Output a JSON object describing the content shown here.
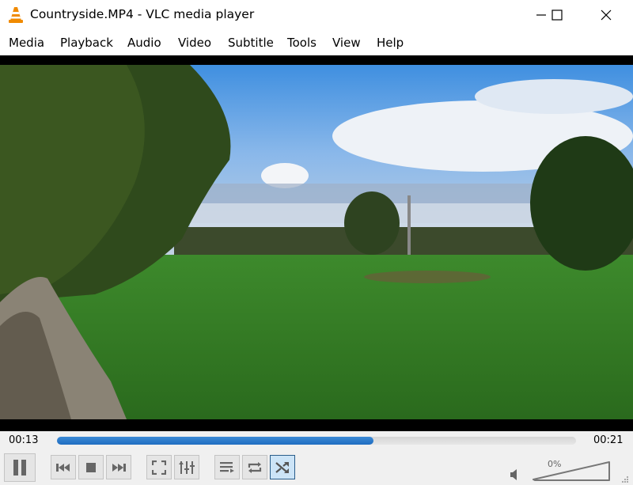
{
  "window": {
    "title": "Countryside.MP4 - VLC media player",
    "app_icon": "vlc-cone-icon",
    "controls": [
      "minimize-icon",
      "maximize-icon",
      "close-icon"
    ]
  },
  "menu": {
    "items": [
      {
        "label": "Media"
      },
      {
        "label": "Playback"
      },
      {
        "label": "Audio"
      },
      {
        "label": "Video"
      },
      {
        "label": "Subtitle"
      },
      {
        "label": "Tools"
      },
      {
        "label": "View"
      },
      {
        "label": "Help"
      }
    ]
  },
  "video": {
    "description": "Countryside scene: green field, trees, blue sky with clouds, stone wall"
  },
  "playback": {
    "elapsed": "00:13",
    "total": "00:21",
    "progress_fraction": 0.61
  },
  "controls": {
    "buttons": [
      {
        "name": "pause-button",
        "icon": "pause-icon"
      },
      {
        "name": "previous-button",
        "icon": "skip-previous-icon"
      },
      {
        "name": "stop-button",
        "icon": "stop-icon"
      },
      {
        "name": "next-button",
        "icon": "skip-next-icon"
      },
      {
        "name": "fullscreen-button",
        "icon": "fullscreen-icon"
      },
      {
        "name": "extended-settings-button",
        "icon": "equalizer-sliders-icon"
      },
      {
        "name": "playlist-button",
        "icon": "playlist-icon"
      },
      {
        "name": "loop-button",
        "icon": "loop-icon"
      },
      {
        "name": "shuffle-button",
        "icon": "shuffle-icon",
        "active": true
      }
    ]
  },
  "volume": {
    "label": "0%",
    "level_percent": 0,
    "icon": "speaker-muted-icon"
  },
  "colors": {
    "accent": "#1f6cc0",
    "active_button_bg": "#cce4f7",
    "active_button_border": "#2a5d8a"
  }
}
